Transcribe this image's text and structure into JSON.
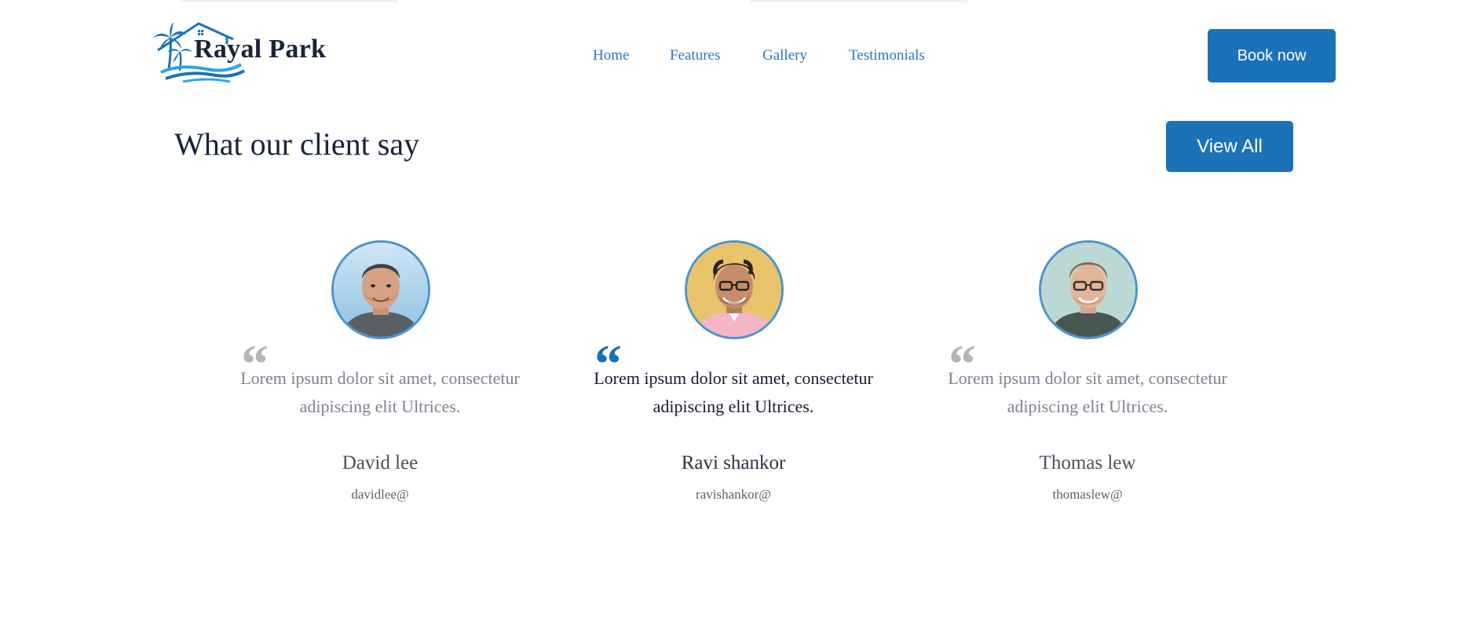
{
  "header": {
    "logo_text": "Rayal Park",
    "nav": [
      {
        "label": "Home"
      },
      {
        "label": "Features"
      },
      {
        "label": "Gallery"
      },
      {
        "label": "Testimonials"
      }
    ],
    "cta_label": "Book now"
  },
  "section": {
    "title": "What our client say",
    "view_all_label": "View All"
  },
  "testimonials": [
    {
      "quote_mark": "“",
      "text": "Lorem ipsum dolor sit amet, consectetur adipiscing elit Ultrices.",
      "name": "David lee",
      "handle": "davidlee@",
      "active": false
    },
    {
      "quote_mark": "“",
      "text": "Lorem ipsum dolor sit amet, consectetur adipiscing elit Ultrices.",
      "name": "Ravi shankor",
      "handle": "ravishankor@",
      "active": true
    },
    {
      "quote_mark": "“",
      "text": "Lorem ipsum dolor sit amet, consectetur adipiscing elit Ultrices.",
      "name": "Thomas lew",
      "handle": "thomaslew@",
      "active": false
    }
  ],
  "colors": {
    "brand_blue": "#1b72b9",
    "nav_link": "#2a77bb",
    "heading": "#172338",
    "muted_text": "#7d8390",
    "avatar_border": "#4b93cf"
  }
}
